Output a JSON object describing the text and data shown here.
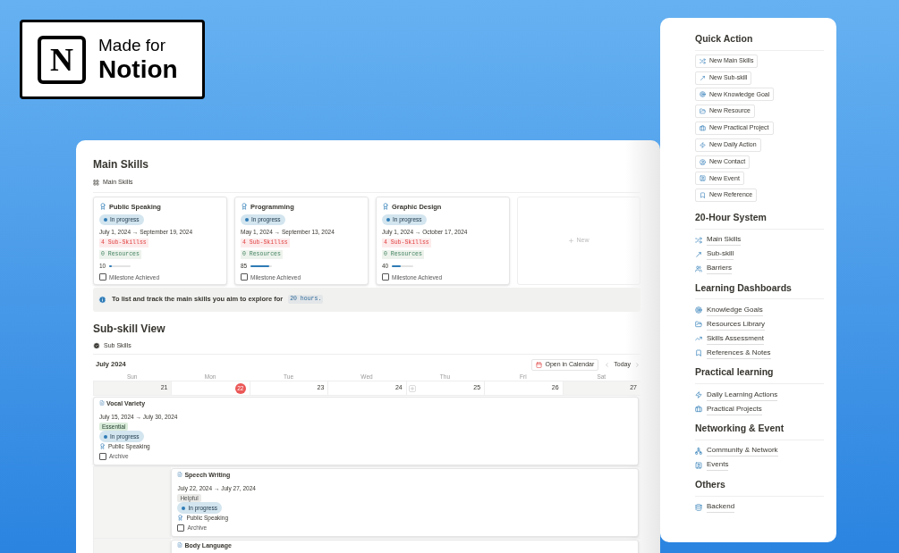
{
  "logo": {
    "letter": "N",
    "line1": "Made for",
    "line2": "Notion"
  },
  "main": {
    "title": "Main Skills",
    "view": "Main Skills",
    "cards": [
      {
        "title": "Public Speaking",
        "status": "In progress",
        "dates": "July 1, 2024 → September 19, 2024",
        "subskills": "4 Sub-Skillss",
        "resources": "0 Resources",
        "progress": "10",
        "level": 0.1,
        "milestone": {
          "label": "Milestone Achieved",
          "checked": false
        }
      },
      {
        "title": "Programming",
        "status": "In progress",
        "dates": "May 1, 2024 → September 13, 2024",
        "subskills": "4 Sub-Skillss",
        "resources": "0 Resources",
        "progress": "85",
        "level": 0.85,
        "milestone": {
          "label": "Milestone Achieved",
          "checked": false
        }
      },
      {
        "title": "Graphic Design",
        "status": "In progress",
        "dates": "July 1, 2024 → October 17, 2024",
        "subskills": "4 Sub-Skillss",
        "resources": "0 Resources",
        "progress": "40",
        "level": 0.4,
        "milestone": {
          "label": "Milestone Achieved",
          "checked": false
        }
      }
    ],
    "new_card": "New",
    "callout": {
      "text": "To list and track the main skills you aim to explore for",
      "code": "20 hours."
    }
  },
  "subskills": {
    "title": "Sub-skill View",
    "view": "Sub Skills",
    "month": "July 2024",
    "open_calendar": "Open in Calendar",
    "today": "Today",
    "days": [
      {
        "weekday": "Sun",
        "date": "21",
        "today": false,
        "weekend": true,
        "add_button": false,
        "events": [
          {
            "title": "Vocal Variety",
            "dates": "July 15, 2024 → July 30, 2024",
            "priority": {
              "label": "Essential",
              "kind": "essential"
            },
            "status": "In progress",
            "skill": "Public Speaking",
            "archive": {
              "label": "Archive",
              "checked": false
            }
          }
        ]
      },
      {
        "weekday": "Mon",
        "date": "22",
        "today": true,
        "weekend": false,
        "add_button": false,
        "events": [
          {
            "title": "Speech Writing",
            "dates": "July 22, 2024 → July 27, 2024",
            "priority": {
              "label": "Helpful",
              "kind": "helpful"
            },
            "status": "In progress",
            "skill": "Public Speaking",
            "archive": {
              "label": "Archive",
              "checked": false
            }
          },
          {
            "title": "Body Language"
          }
        ]
      },
      {
        "weekday": "Tue",
        "date": "23",
        "today": false,
        "weekend": false,
        "add_button": false
      },
      {
        "weekday": "Wed",
        "date": "24",
        "today": false,
        "weekend": false,
        "add_button": false
      },
      {
        "weekday": "Thu",
        "date": "25",
        "today": false,
        "weekend": false,
        "add_button": true
      },
      {
        "weekday": "Fri",
        "date": "26",
        "today": false,
        "weekend": false,
        "add_button": false
      },
      {
        "weekday": "Sat",
        "date": "27",
        "today": false,
        "weekend": true,
        "add_button": false
      }
    ]
  },
  "sidebar": {
    "sections": [
      {
        "title": "Quick Action",
        "kind": "buttons",
        "items": [
          "New Main Skills",
          "New Sub-skill",
          "New Knowledge Goal",
          "New Resource",
          "New Practical Project",
          "New Daily Action",
          "New Contact",
          "New Event",
          "New Reference"
        ]
      },
      {
        "title": "20-Hour System",
        "kind": "links",
        "items": [
          "Main Skills",
          "Sub-skill",
          "Barriers"
        ]
      },
      {
        "title": "Learning Dashboards",
        "kind": "links",
        "items": [
          "Knowledge Goals",
          "Resources Library",
          "Skills Assessment",
          "References & Notes"
        ]
      },
      {
        "title": "Practical learning",
        "kind": "links",
        "items": [
          "Daily Learning Actions",
          "Practical Projects"
        ]
      },
      {
        "title": "Networking & Event",
        "kind": "links",
        "items": [
          "Community & Network",
          "Events"
        ]
      },
      {
        "title": "Others",
        "kind": "links",
        "items": [
          "Backend"
        ]
      }
    ]
  }
}
